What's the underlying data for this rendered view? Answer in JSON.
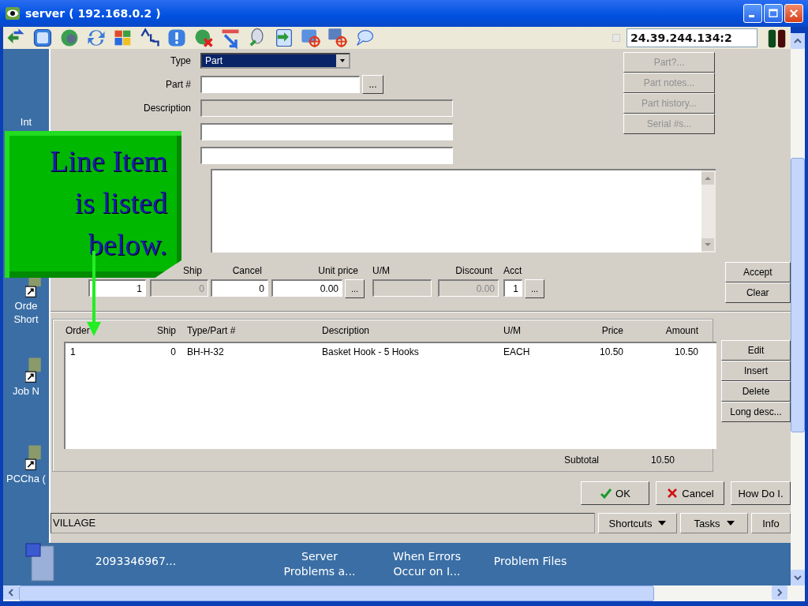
{
  "window": {
    "title": "server ( 192.168.0.2 )"
  },
  "toolbar": {
    "address": "24.39.244.134:2"
  },
  "desktop": {
    "icons": [
      {
        "label": "Int"
      },
      {
        "label": "Orde Short"
      },
      {
        "label": "Job N"
      },
      {
        "label": "PCCha ("
      }
    ],
    "bottom_items": [
      "2093346967...",
      "Server Problems a...",
      "When Errors Occur on I...",
      "Problem Files"
    ]
  },
  "form": {
    "type": {
      "label": "Type",
      "value": "Part"
    },
    "part": {
      "label": "Part #",
      "button": "..."
    },
    "description": {
      "label": "Description",
      "disabled": true
    }
  },
  "part_buttons": [
    {
      "label": "Part?...",
      "disabled": true
    },
    {
      "label": "Part notes...",
      "disabled": true
    },
    {
      "label": "Part history...",
      "disabled": true
    },
    {
      "label": "Serial #s...",
      "disabled": true
    }
  ],
  "entry": [
    {
      "value": "1",
      "disabled": false
    },
    {
      "label": "Ship",
      "value": "0",
      "disabled": true
    },
    {
      "label": "Cancel",
      "value": "0",
      "disabled": false
    },
    {
      "label": "Unit price",
      "value": "0.00",
      "disabled": false,
      "button": "..."
    },
    {
      "label": "U/M",
      "disabled": true
    },
    {
      "label": "Discount",
      "value": "0.00",
      "disabled": true
    },
    {
      "label": "Acct",
      "value": "1",
      "disabled": false,
      "button": "..."
    }
  ],
  "entry_buttons": [
    "Accept",
    "Clear"
  ],
  "lines": {
    "columns": [
      "Order",
      "Ship",
      "Type/Part #",
      "Description",
      "U/M",
      "Price",
      "Amount"
    ],
    "rows": [
      [
        "1",
        "0",
        "BH-H-32",
        "Basket Hook - 5 Hooks",
        "EACH",
        "10.50",
        "10.50"
      ]
    ],
    "subtotal_label": "Subtotal",
    "subtotal": "10.50"
  },
  "line_buttons": [
    "Edit",
    "Insert",
    "Delete",
    "Long desc..."
  ],
  "dialog_buttons": [
    {
      "label": "OK",
      "kind": "ok"
    },
    {
      "label": "Cancel",
      "kind": "cancel"
    },
    {
      "label": "How Do I.",
      "kind": "plain"
    }
  ],
  "status_bar": {
    "text": "VILLAGE",
    "menus": [
      {
        "label": "Shortcuts",
        "dropdown": true
      },
      {
        "label": "Tasks",
        "dropdown": true
      },
      {
        "label": "Info",
        "dropdown": false
      }
    ]
  },
  "callout": {
    "text": "Line Item is listed below."
  }
}
